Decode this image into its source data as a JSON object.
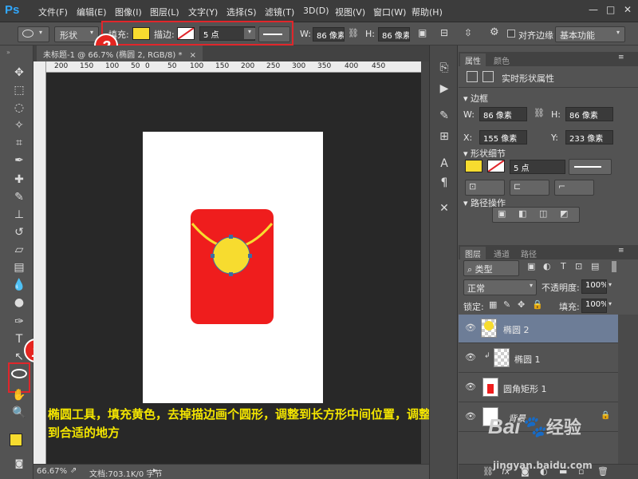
{
  "menubar": {
    "logo": "Ps",
    "items": [
      "文件(F)",
      "编辑(E)",
      "图像(I)",
      "图层(L)",
      "文字(Y)",
      "选择(S)",
      "滤镜(T)",
      "3D(D)",
      "视图(V)",
      "窗口(W)",
      "帮助(H)"
    ],
    "minimize": "—",
    "maximize": "□",
    "close": "✕"
  },
  "options": {
    "mode": "形状",
    "fill_label": "填充:",
    "fill_color": "#f7dc2f",
    "stroke_label": "描边:",
    "stroke_size": "5 点",
    "w_label": "W:",
    "w_value": "86 像素",
    "h_label": "H:",
    "h_value": "86 像素",
    "align_edges": "对齐边缘",
    "workspace": "基本功能",
    "badge2": "2"
  },
  "toolbar": {
    "badge1": "1",
    "fg_color": "#f7dc2f",
    "bg_color": "#ffffff"
  },
  "document": {
    "tab": "未标题-1 @ 66.7% (椭圆 2, RGB/8) *",
    "close": "×",
    "ruler_ticks": [
      "200",
      "150",
      "100",
      "50",
      "0",
      "50",
      "100",
      "150",
      "200",
      "250",
      "300",
      "350",
      "400",
      "450"
    ],
    "zoom": "66.67%",
    "doc_info": "文档:703.1K/0 字节"
  },
  "caption": "椭圆工具，填充黄色，去掉描边画个圆形，调整到长方形中间位置，调整到合适的地方",
  "properties": {
    "tab_props": "属性",
    "tab_color": "颜色",
    "title": "实时形状属性",
    "section_bounds": "边框",
    "w_label": "W:",
    "w_value": "86 像素",
    "h_label": "H:",
    "h_value": "86 像素",
    "x_label": "X:",
    "x_value": "155 像素",
    "y_label": "Y:",
    "y_value": "233 像素",
    "section_shape": "形状细节",
    "stroke_size": "5 点",
    "section_path": "路径操作"
  },
  "layers": {
    "tab_layers": "图层",
    "tab_channels": "通道",
    "tab_paths": "路径",
    "filter": "类型",
    "blend": "正常",
    "opacity_label": "不透明度:",
    "opacity": "100%",
    "lock_label": "锁定:",
    "fill_label": "填充:",
    "fill": "100%",
    "items": [
      {
        "name": "椭圆 2"
      },
      {
        "name": "椭圆 1"
      },
      {
        "name": "圆角矩形 1"
      },
      {
        "name": "背景"
      }
    ]
  },
  "watermark": {
    "brand": "Bai",
    "brand2": "经验",
    "url": "jingyan.baidu.com"
  }
}
